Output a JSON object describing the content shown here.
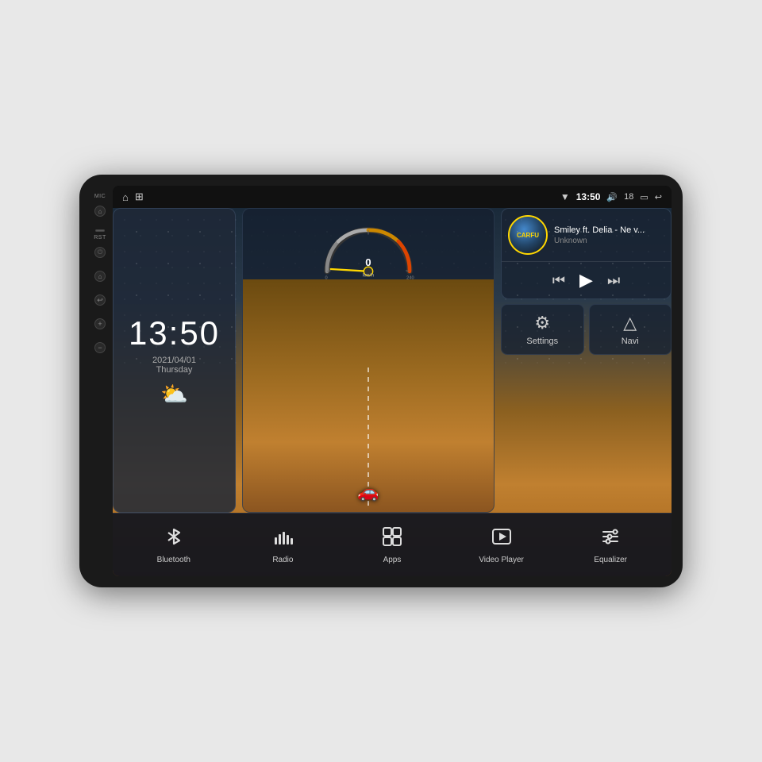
{
  "device": {
    "background": "#1a1a1a"
  },
  "statusBar": {
    "time": "13:50",
    "volume": "18",
    "icons": [
      "wifi",
      "volume",
      "battery",
      "back"
    ]
  },
  "sideButtons": {
    "micLabel": "MIC",
    "rstLabel": "RST",
    "buttons": [
      "home",
      "power",
      "home2",
      "back",
      "add",
      "subtract"
    ]
  },
  "clock": {
    "time": "13:50",
    "date": "2021/04/01",
    "day": "Thursday"
  },
  "music": {
    "title": "Smiley ft. Delia - Ne v...",
    "artist": "Unknown",
    "albumText": "CARFU"
  },
  "speedometer": {
    "value": "0",
    "unit": "km/h",
    "minSpeed": "0",
    "maxSpeed": "240"
  },
  "appButtons": {
    "settings": "Settings",
    "navi": "Navi"
  },
  "bottomBar": {
    "items": [
      {
        "id": "bluetooth",
        "label": "Bluetooth",
        "icon": "bluetooth"
      },
      {
        "id": "radio",
        "label": "Radio",
        "icon": "radio"
      },
      {
        "id": "apps",
        "label": "Apps",
        "icon": "apps"
      },
      {
        "id": "video-player",
        "label": "Video Player",
        "icon": "video"
      },
      {
        "id": "equalizer",
        "label": "Equalizer",
        "icon": "equalizer"
      }
    ]
  }
}
